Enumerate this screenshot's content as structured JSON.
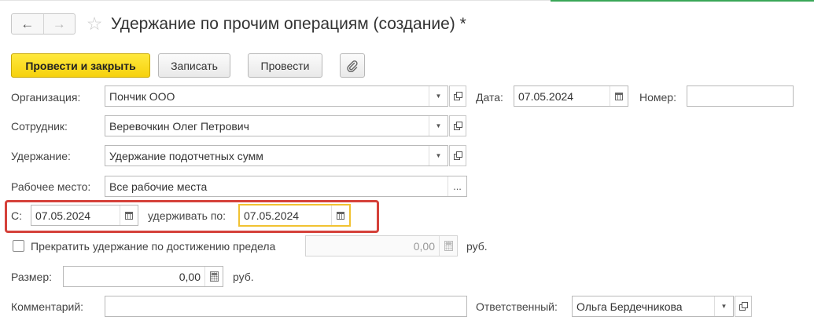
{
  "nav": {
    "back_icon": "←",
    "forward_icon": "→",
    "favorite_icon": "☆"
  },
  "title": "Удержание по прочим операциям (создание) *",
  "toolbar": {
    "post_close": "Провести и закрыть",
    "save": "Записать",
    "post": "Провести",
    "attach_icon": "paperclip-icon"
  },
  "form": {
    "organization": {
      "label": "Организация:",
      "value": "Пончик ООО"
    },
    "date": {
      "label": "Дата:",
      "value": "07.05.2024"
    },
    "number": {
      "label": "Номер:",
      "value": ""
    },
    "employee": {
      "label": "Сотрудник:",
      "value": "Веревочкин Олег Петрович"
    },
    "deduction": {
      "label": "Удержание:",
      "value": "Удержание подотчетных сумм"
    },
    "workplace": {
      "label": "Рабочее место:",
      "value": "Все рабочие места",
      "select_btn": "..."
    },
    "from": {
      "label": "С:",
      "value": "07.05.2024"
    },
    "until": {
      "label": "удерживать по:",
      "value": "07.05.2024"
    },
    "stop_limit": {
      "label": "Прекратить удержание по достижению предела",
      "checked": false,
      "value": "0,00",
      "unit": "руб."
    },
    "amount": {
      "label": "Размер:",
      "value": "0,00",
      "unit": "руб."
    },
    "comment": {
      "label": "Комментарий:",
      "value": ""
    },
    "responsible": {
      "label": "Ответственный:",
      "value": "Ольга Бердечникова"
    }
  },
  "colors": {
    "highlight_border": "#d5413a",
    "focus_border": "#f1c232",
    "primary_button": "#f6d10e",
    "top_accent": "#3aa757"
  }
}
